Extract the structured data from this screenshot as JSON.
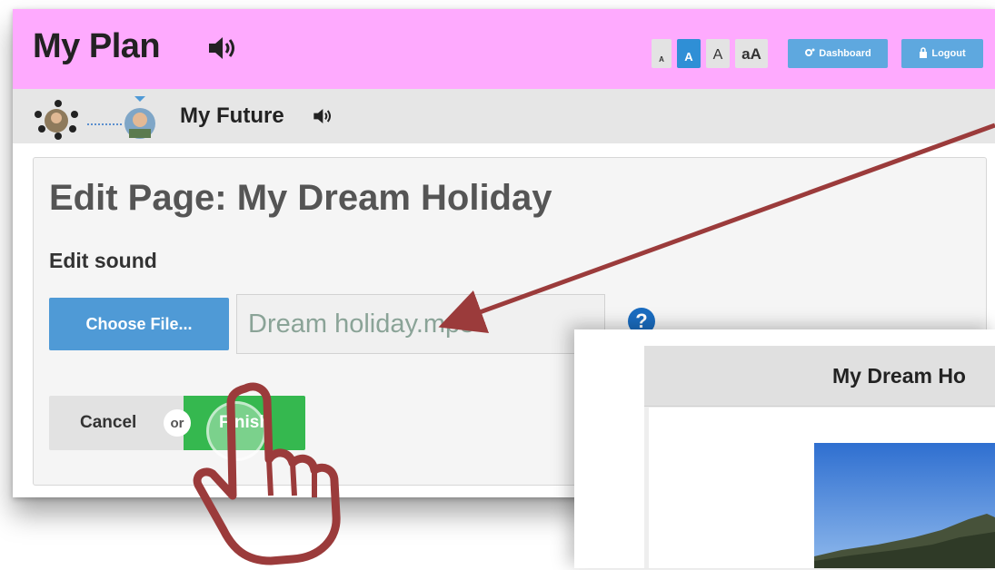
{
  "header": {
    "app_title": "My Plan",
    "font_sizes": [
      "A",
      "A",
      "A",
      "aA"
    ],
    "active_font_index": 1,
    "dashboard_label": "Dashboard",
    "logout_label": "Logout"
  },
  "breadcrumb": {
    "current_label": "My Future"
  },
  "edit": {
    "title": "Edit Page: My Dream Holiday",
    "section_label": "Edit sound",
    "choose_file_label": "Choose File...",
    "file_name": "Dream holiday.mp3",
    "help_symbol": "?",
    "cancel_label": "Cancel",
    "or_label": "or",
    "finish_label": "Finish"
  },
  "preview": {
    "title": "My Dream Ho"
  },
  "colors": {
    "header_bg": "#feaafe",
    "accent_blue": "#4f9ad6",
    "finish_green": "#35b84f",
    "annotation_red": "#9b3b3b"
  },
  "icons": [
    "speaker-icon",
    "gear-icon",
    "lock-icon",
    "help-icon",
    "pointing-hand-icon",
    "arrow-annotation"
  ]
}
